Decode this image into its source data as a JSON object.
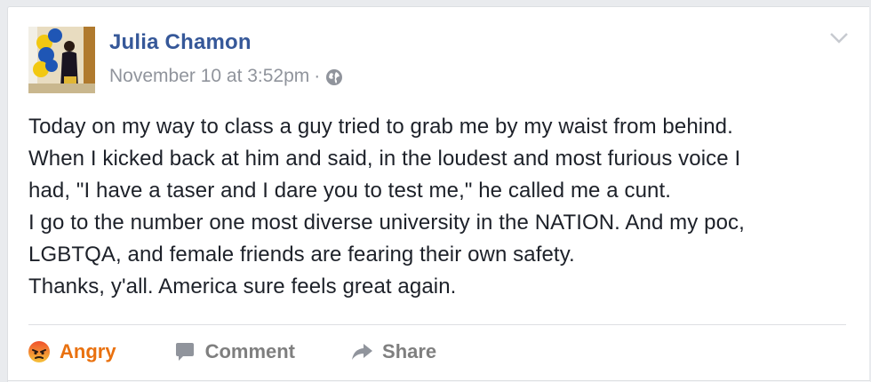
{
  "post": {
    "author": "Julia Chamon",
    "timestamp": "November 10 at 3:52pm",
    "separator": "·",
    "privacy_icon": "globe-icon",
    "menu_icon": "chevron-down-icon",
    "lines": [
      "Today on my way to class a guy tried to grab me by my waist from behind.",
      "When I kicked back at him and said, in the loudest and most furious voice I",
      "had, \"I have a taser and I dare you to test me,\" he called me a cunt.",
      "I go to the number one most diverse university in the NATION. And my poc,",
      "LGBTQA, and female friends are fearing their own safety.",
      "Thanks, y'all. America sure feels great again."
    ]
  },
  "actions": {
    "angry_label": "Angry",
    "comment_label": "Comment",
    "share_label": "Share"
  },
  "colors": {
    "author": "#365899",
    "meta": "#90949c",
    "text": "#1d2129",
    "angry": "#e9710f",
    "action": "#7f7f7f"
  }
}
